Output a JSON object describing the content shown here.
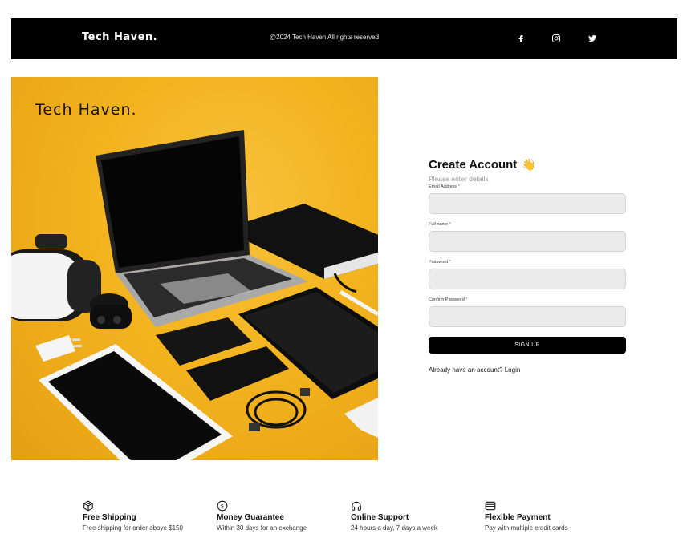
{
  "header": {
    "brand": "Tech Haven.",
    "copyright": "@2024 Tech Haven All rights reserved",
    "social": [
      {
        "icon": "facebook-icon"
      },
      {
        "icon": "instagram-icon"
      },
      {
        "icon": "twitter-icon"
      }
    ]
  },
  "hero": {
    "brand": "Tech Haven.",
    "background_color": "#f3b31f"
  },
  "form": {
    "title": "Create Account",
    "title_emoji": "👋",
    "subtitle": "Please enter details",
    "fields": [
      {
        "label": "Email Address",
        "required_mark": "*",
        "value": ""
      },
      {
        "label": "Full name",
        "required_mark": "*",
        "value": ""
      },
      {
        "label": "Password",
        "required_mark": "*",
        "value": ""
      },
      {
        "label": "Confirm Password",
        "required_mark": "*",
        "value": ""
      }
    ],
    "submit_label": "SIGN UP",
    "login_text": "Already have an account? Login"
  },
  "features": [
    {
      "icon": "package-icon",
      "title": "Free Shipping",
      "desc": "Free shipping for order above $150"
    },
    {
      "icon": "dollar-circle-icon",
      "title": "Money Guarantee",
      "desc": "Within 30 days for an exchange"
    },
    {
      "icon": "headphones-icon",
      "title": "Online Support",
      "desc": "24 hours a day, 7 days a week"
    },
    {
      "icon": "credit-card-icon",
      "title": "Flexible Payment",
      "desc": "Pay with multiple credit cards"
    }
  ],
  "colors": {
    "accent": "#000000",
    "required": "#e25555",
    "input_bg": "#ebebeb"
  }
}
